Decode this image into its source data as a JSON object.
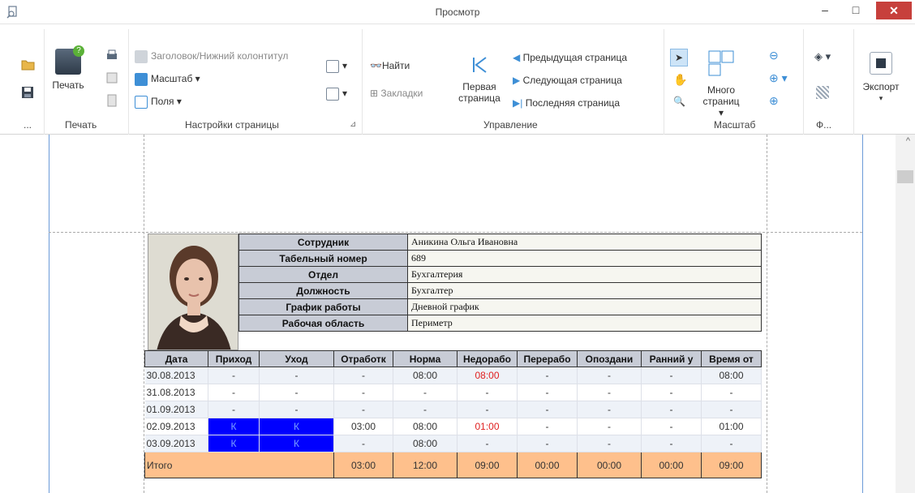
{
  "window": {
    "title": "Просмотр",
    "minimize": "–",
    "maximize": "□",
    "close": "✕"
  },
  "ribbon": {
    "print_group": {
      "print": "Печать",
      "label": "Печать"
    },
    "page_settings": {
      "header_footer": "Заголовок/Нижний колонтитул",
      "scale": "Масштаб",
      "margins": "Поля",
      "label": "Настройки страницы"
    },
    "navigation": {
      "find": "Найти",
      "bookmarks": "Закладки",
      "first_page_line1": "Первая",
      "first_page_line2": "страница",
      "prev_page": "Предыдущая страница",
      "next_page": "Следующая страница",
      "last_page": "Последняя страница",
      "label": "Управление"
    },
    "zoom": {
      "many_pages_line1": "Много",
      "many_pages_line2": "страниц",
      "label": "Масштаб"
    },
    "background": {
      "label": "Ф..."
    },
    "export": {
      "label": "Экспорт"
    },
    "more": "..."
  },
  "report": {
    "info": [
      {
        "key": "Сотрудник",
        "value": "Аникина Ольга Ивановна"
      },
      {
        "key": "Табельный номер",
        "value": "689"
      },
      {
        "key": "Отдел",
        "value": "Бухгалтерия"
      },
      {
        "key": "Должность",
        "value": "Бухгалтер"
      },
      {
        "key": "График работы",
        "value": "Дневной график"
      },
      {
        "key": "Рабочая область",
        "value": "Периметр"
      }
    ],
    "columns": [
      "Дата",
      "Приход",
      "Уход",
      "Отработк",
      "Норма",
      "Недорабо",
      "Перерабо",
      "Опоздани",
      "Ранний у",
      "Время от"
    ],
    "rows": [
      [
        "30.08.2013",
        "-",
        "-",
        "-",
        "08:00",
        "08:00",
        "-",
        "-",
        "-",
        "08:00"
      ],
      [
        "31.08.2013",
        "-",
        "-",
        "-",
        "-",
        "-",
        "-",
        "-",
        "-",
        "-"
      ],
      [
        "01.09.2013",
        "-",
        "-",
        "-",
        "-",
        "-",
        "-",
        "-",
        "-",
        "-"
      ],
      [
        "02.09.2013",
        "К",
        "К",
        "03:00",
        "08:00",
        "01:00",
        "-",
        "-",
        "-",
        "01:00"
      ],
      [
        "03.09.2013",
        "К",
        "К",
        "-",
        "08:00",
        "-",
        "-",
        "-",
        "-",
        "-"
      ]
    ],
    "total": [
      "Итого",
      "03:00",
      "12:00",
      "09:00",
      "00:00",
      "00:00",
      "00:00",
      "09:00"
    ]
  }
}
